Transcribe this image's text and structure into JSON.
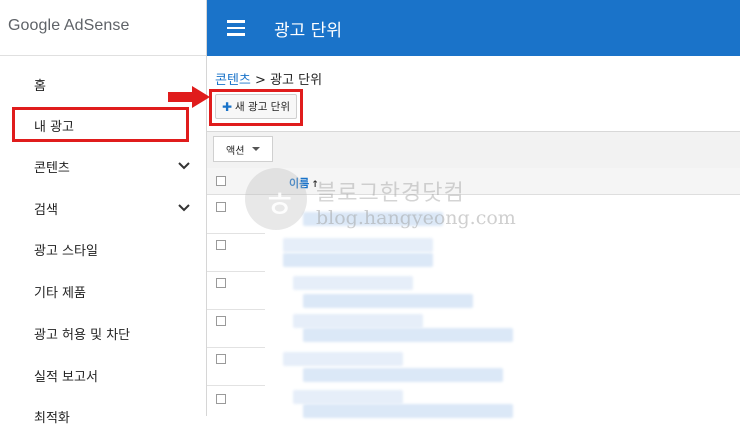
{
  "logo": "Google AdSense",
  "topbar": {
    "title": "광고 단위"
  },
  "sidebar": {
    "items": [
      {
        "label": "홈"
      },
      {
        "label": "내 광고"
      },
      {
        "label": "콘텐츠"
      },
      {
        "label": "검색"
      },
      {
        "label": "광고 스타일"
      },
      {
        "label": "기타 제품"
      },
      {
        "label": "광고 허용 및 차단"
      },
      {
        "label": "실적 보고서"
      },
      {
        "label": "최적화"
      }
    ]
  },
  "breadcrumb": {
    "parent": "콘텐츠",
    "separator": ">",
    "current": "광고 단위"
  },
  "toolbar": {
    "new_ad_unit": "새 광고 단위",
    "action": "액션"
  },
  "table": {
    "column_name": "이름",
    "sort_glyph": "↑"
  },
  "watermark": {
    "line1": "블로그한경닷컴",
    "line2": "blog.hangyeong.com",
    "logo_glyph": "ㅎ"
  },
  "colors": {
    "primary": "#1a73c9",
    "highlight": "#e01c1c"
  },
  "icons": [
    "menu-icon",
    "chevron-down-icon",
    "plus-icon",
    "arrow-right-icon",
    "sort-up-icon"
  ]
}
